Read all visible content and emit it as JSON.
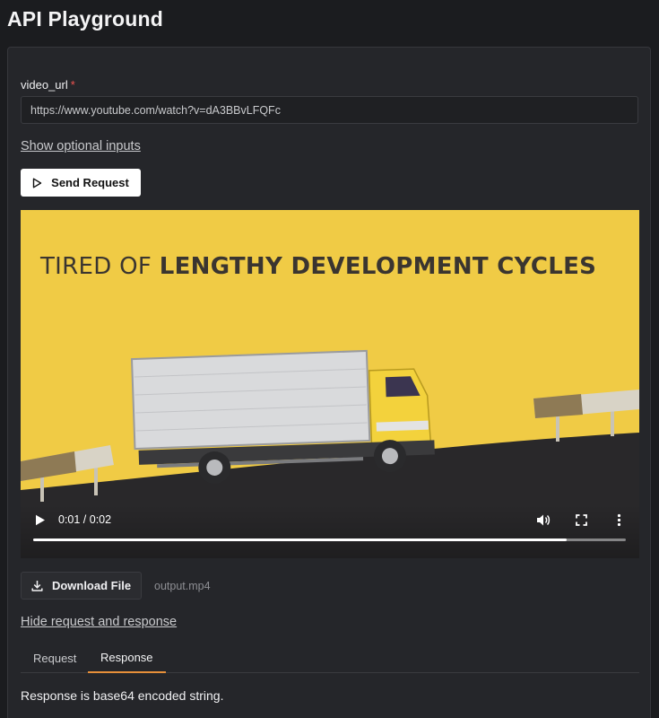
{
  "app": {
    "title": "API Playground"
  },
  "form": {
    "video_url_label": "video_url",
    "required_marker": "*",
    "video_url_value": "https://www.youtube.com/watch?v=dA3BBvLFQFc",
    "show_optional_label": "Show optional inputs",
    "send_label": "Send Request"
  },
  "player": {
    "caption_light": "TIRED OF ",
    "caption_bold": "LENGTHY DEVELOPMENT CYCLES",
    "time": "0:01 / 0:02",
    "progress": 0.9,
    "icons": [
      "play-icon",
      "volume-icon",
      "fullscreen-icon",
      "more-options-icon"
    ]
  },
  "output": {
    "download_label": "Download File",
    "file_name": "output.mp4",
    "hide_label": "Hide request and response"
  },
  "tabs": [
    {
      "label": "Request",
      "active": false
    },
    {
      "label": "Response",
      "active": true
    }
  ],
  "response": {
    "text": "Response is base64 encoded string."
  },
  "colors": {
    "background": "#1b1c1f",
    "panel": "#25262a",
    "video_bg": "#f0cb45",
    "accent_tab": "#e8903a",
    "required": "#ef5350"
  }
}
